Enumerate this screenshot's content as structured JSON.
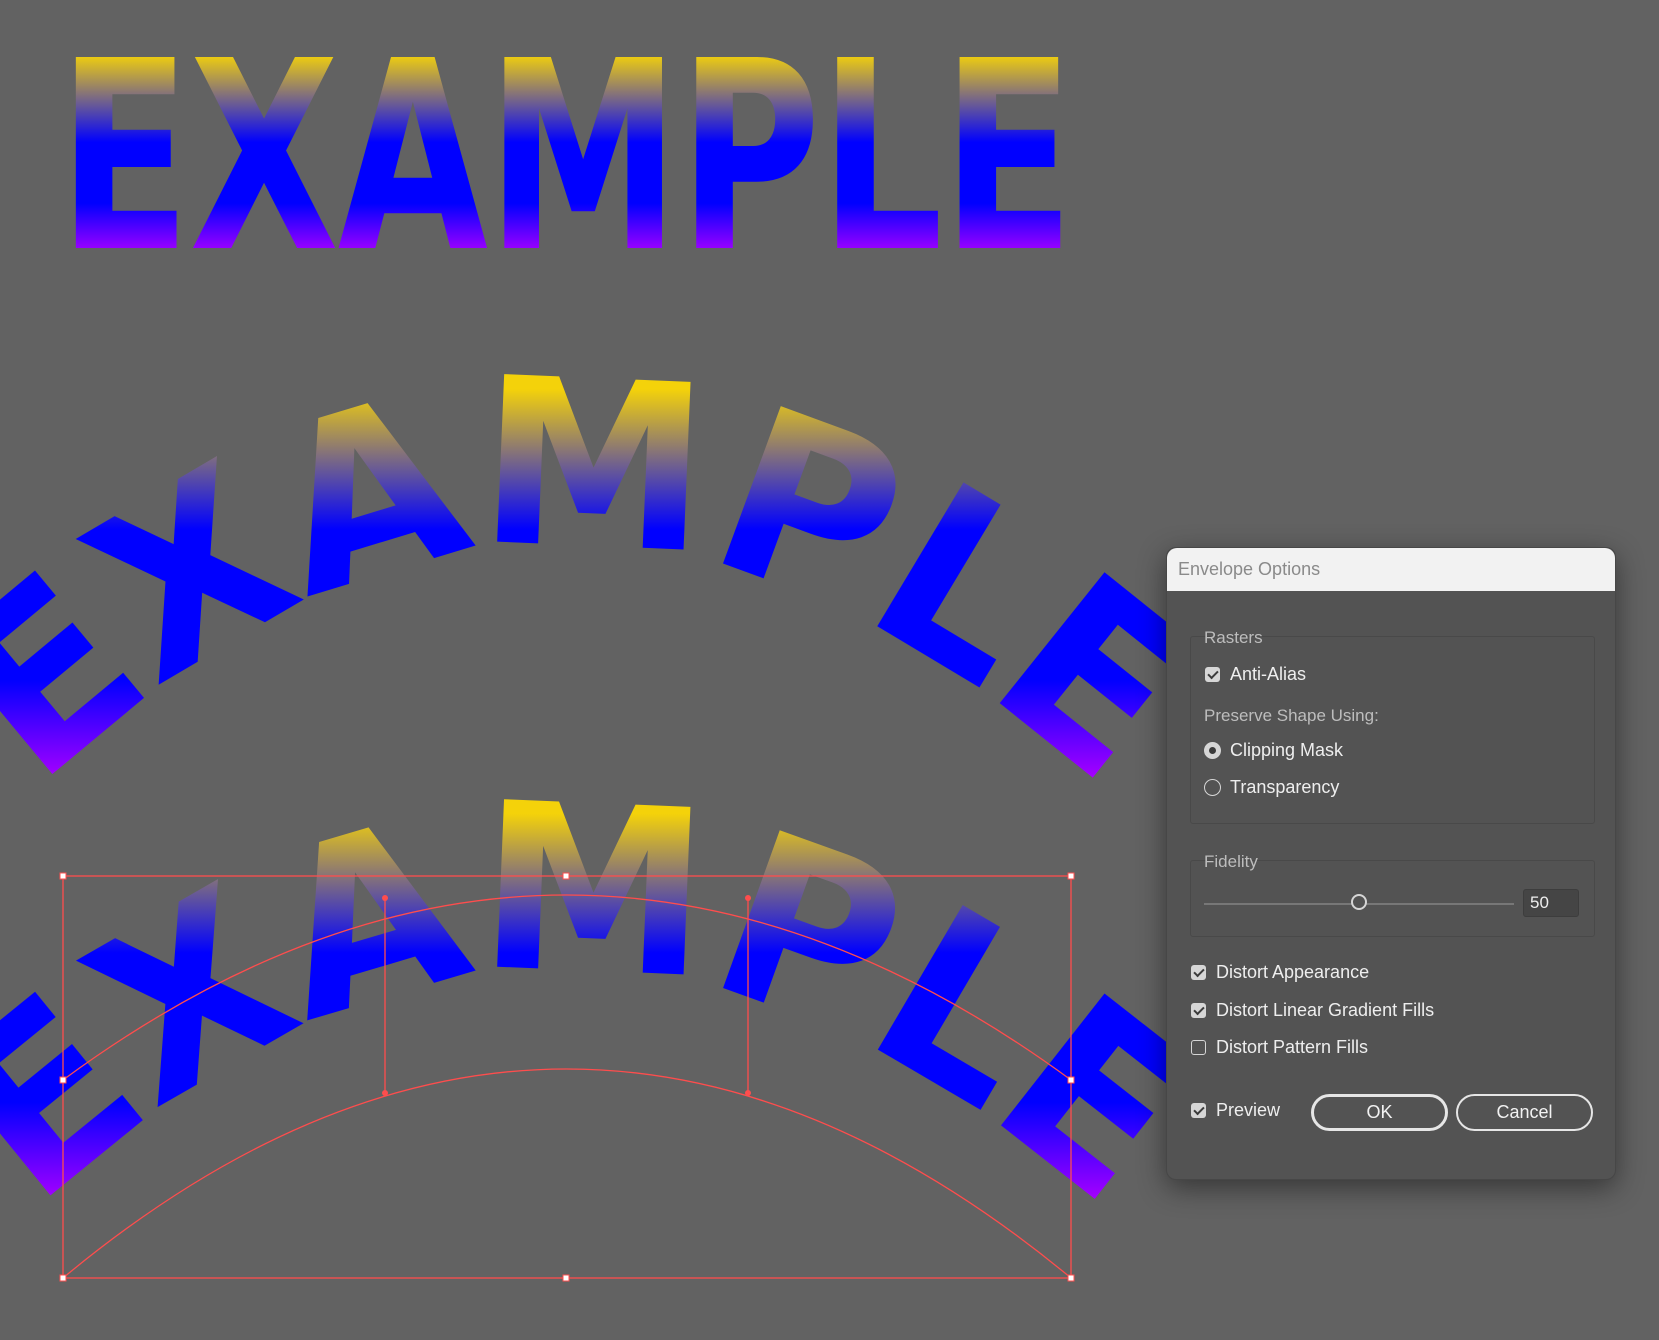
{
  "canvas": {
    "art_text": "EXAMPLE",
    "gradient_colors": [
      "#f4d20a",
      "#0000ff",
      "#ff00ff"
    ],
    "background_color": "#626262",
    "selection_color": "#ff4d4d"
  },
  "dialog": {
    "title": "Envelope Options",
    "rasters": {
      "label": "Rasters",
      "anti_alias": {
        "label": "Anti-Alias",
        "checked": true
      },
      "preserve_label": "Preserve Shape Using:",
      "clipping_mask": {
        "label": "Clipping Mask",
        "selected": true
      },
      "transparency": {
        "label": "Transparency",
        "selected": false
      }
    },
    "fidelity": {
      "label": "Fidelity",
      "value": "50"
    },
    "distort_appearance": {
      "label": "Distort Appearance",
      "checked": true
    },
    "distort_linear_gradient": {
      "label": "Distort Linear Gradient Fills",
      "checked": true
    },
    "distort_pattern": {
      "label": "Distort Pattern Fills",
      "checked": false
    },
    "preview": {
      "label": "Preview",
      "checked": true
    },
    "ok_label": "OK",
    "cancel_label": "Cancel"
  }
}
